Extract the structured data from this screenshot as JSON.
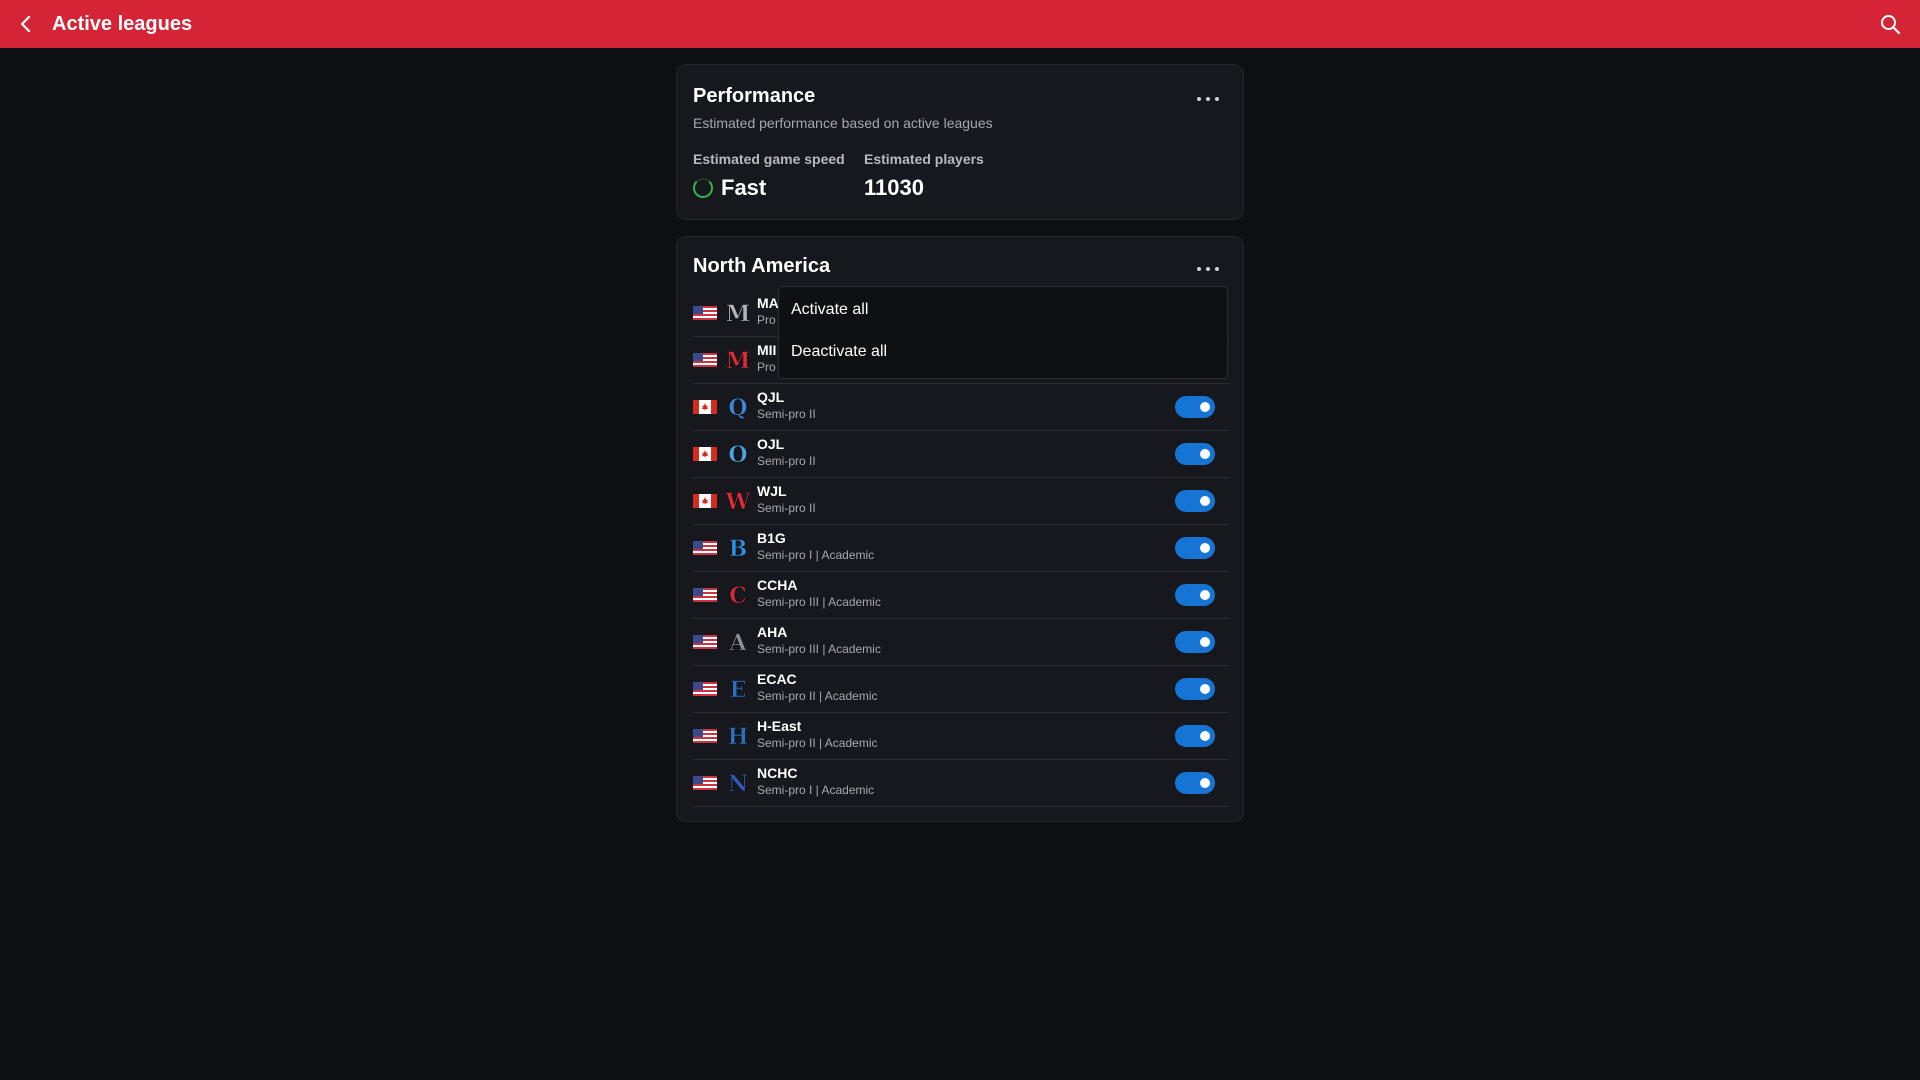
{
  "header": {
    "title": "Active leagues",
    "back_icon": "chevron-left-icon",
    "search_icon": "search-icon"
  },
  "performance": {
    "title": "Performance",
    "subtitle": "Estimated performance based on active leagues",
    "speed_label": "Estimated game speed",
    "speed_value": "Fast",
    "players_label": "Estimated players",
    "players_value": "11030"
  },
  "region": {
    "title": "North America",
    "leagues": [
      {
        "name": "MA",
        "sub": "Pro",
        "flag": "us",
        "logo": "M",
        "logo_color": "#b0b4bb",
        "active": true
      },
      {
        "name": "MII",
        "sub": "Pro",
        "flag": "us",
        "logo": "M",
        "logo_color": "#e02a3a",
        "active": true
      },
      {
        "name": "QJL",
        "sub": "Semi-pro II",
        "flag": "ca",
        "logo": "Q",
        "logo_color": "#3a86d8",
        "active": true
      },
      {
        "name": "OJL",
        "sub": "Semi-pro II",
        "flag": "ca",
        "logo": "O",
        "logo_color": "#4aa4e0",
        "active": true
      },
      {
        "name": "WJL",
        "sub": "Semi-pro II",
        "flag": "ca",
        "logo": "W",
        "logo_color": "#e02a3a",
        "active": true
      },
      {
        "name": "B1G",
        "sub": "Semi-pro I | Academic",
        "flag": "us",
        "logo": "B",
        "logo_color": "#2f8fe0",
        "active": true
      },
      {
        "name": "CCHA",
        "sub": "Semi-pro III | Academic",
        "flag": "us",
        "logo": "C",
        "logo_color": "#d8283a",
        "active": true
      },
      {
        "name": "AHA",
        "sub": "Semi-pro III | Academic",
        "flag": "us",
        "logo": "A",
        "logo_color": "#8a8f99",
        "active": true
      },
      {
        "name": "ECAC",
        "sub": "Semi-pro II | Academic",
        "flag": "us",
        "logo": "E",
        "logo_color": "#2c6fc0",
        "active": true
      },
      {
        "name": "H-East",
        "sub": "Semi-pro II | Academic",
        "flag": "us",
        "logo": "H",
        "logo_color": "#2c6fc0",
        "active": true
      },
      {
        "name": "NCHC",
        "sub": "Semi-pro I | Academic",
        "flag": "us",
        "logo": "N",
        "logo_color": "#3358b8",
        "active": true
      }
    ]
  },
  "menu": {
    "activate_all": "Activate all",
    "deactivate_all": "Deactivate all"
  },
  "colors": {
    "header": "#d42436",
    "toggle_on": "#1574d4",
    "speed_ring": "#38b24a"
  }
}
